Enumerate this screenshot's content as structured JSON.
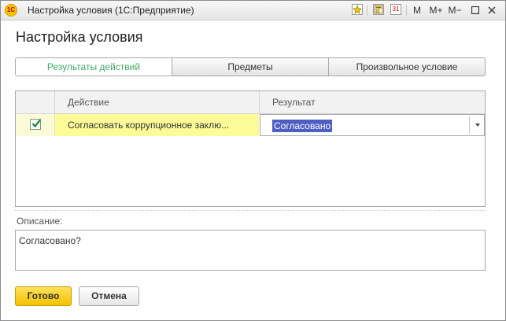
{
  "window": {
    "title": "Настройка условия  (1С:Предприятие)",
    "logo_text": "1С",
    "toolbar": {
      "m_label": "M",
      "m_plus_label": "M+",
      "m_minus_label": "M−",
      "calendar_day": "31"
    }
  },
  "page": {
    "heading": "Настройка условия"
  },
  "tabs": [
    {
      "label": "Результаты действий",
      "active": true
    },
    {
      "label": "Предметы",
      "active": false
    },
    {
      "label": "Произвольное условие",
      "active": false
    }
  ],
  "grid": {
    "columns": {
      "action": "Действие",
      "result": "Результат"
    },
    "rows": [
      {
        "checked": true,
        "action": "Согласовать коррупционное заклю...",
        "result": "Согласовано"
      }
    ]
  },
  "description": {
    "label": "Описание:",
    "value": "Согласовано?"
  },
  "buttons": {
    "ok": "Готово",
    "cancel": "Отмена"
  },
  "colors": {
    "accent_yellow": "#f3c200",
    "active_tab_text": "#3fa96a",
    "row_highlight": "#fbfb98",
    "selection": "#4f5ec1"
  }
}
